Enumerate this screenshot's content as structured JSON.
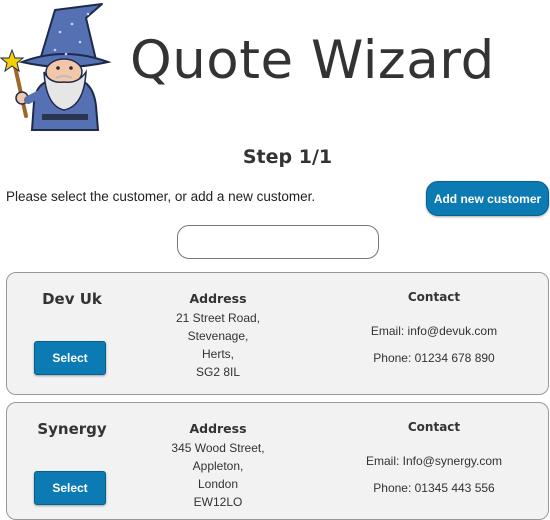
{
  "header": {
    "title": "Quote Wizard",
    "logo_icon": "wizard-mascot-icon"
  },
  "step": {
    "label": "Step 1/1"
  },
  "instruction": "Please select the customer, or add a new customer.",
  "add_customer_button": "Add new customer",
  "search": {
    "value": "",
    "placeholder": ""
  },
  "customers": [
    {
      "name": "Dev Uk",
      "select_label": "Select",
      "address_heading": "Address",
      "address_lines": [
        "21 Street Road,",
        "Stevenage,",
        "Herts,",
        "SG2 8IL"
      ],
      "contact_heading": "Contact",
      "email": "Email: info@devuk.com",
      "phone": "Phone: 01234 678 890"
    },
    {
      "name": "Synergy",
      "select_label": "Select",
      "address_heading": "Address",
      "address_lines": [
        "345 Wood Street,",
        "Appleton,",
        "London",
        "EW12LO"
      ],
      "contact_heading": "Contact",
      "email": "Email: Info@synergy.com",
      "phone": "Phone: 01345 443 556"
    }
  ],
  "colors": {
    "primary_button": "#0c7bb3",
    "card_background": "#f2f2f2",
    "title_text": "#333333"
  }
}
